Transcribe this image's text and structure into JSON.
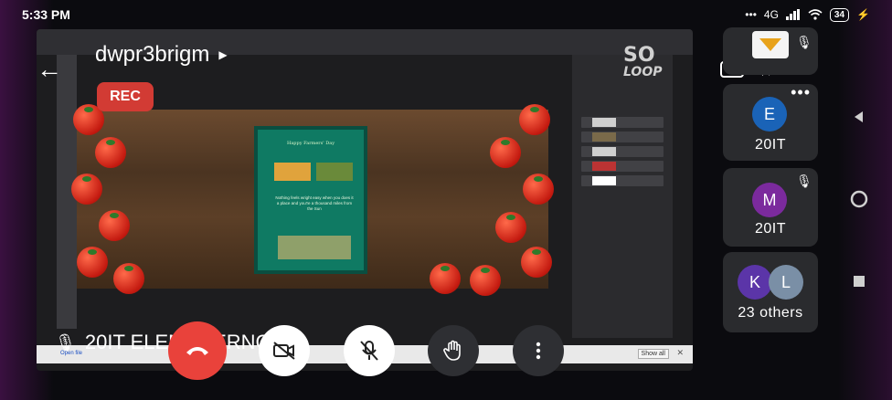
{
  "status_bar": {
    "time": "5:33 PM",
    "network": "4G",
    "battery": "34"
  },
  "meeting": {
    "code": "dwpr3brigm",
    "rec_label": "REC",
    "presenter_label": "20IT ELENA FERNCY"
  },
  "shared_screen": {
    "card_title": "Happy Farmers' Day",
    "card_text": "Nothing feels wright easy when you does it a place and you're a thousand miles from the Sun",
    "watermark_top": "SO",
    "watermark_bottom": "LOOP",
    "taskbar_link": "Open file",
    "taskbar_button": "Show all"
  },
  "participants": [
    {
      "type": "logo",
      "muted": true
    },
    {
      "initial": "E",
      "name": "20IT",
      "color": "#1a63b7"
    },
    {
      "initial": "M",
      "name": "20IT",
      "color": "#7b2a9d",
      "muted": true
    },
    {
      "initials": [
        "K",
        "L"
      ],
      "name": "23 others",
      "colors": [
        "#5b35a8",
        "#7a8fa6"
      ]
    }
  ],
  "icons": {
    "back": "back-arrow-icon",
    "switch_camera": "switch-camera-icon",
    "speaker": "speaker-icon",
    "end_call": "end-call-icon",
    "camera_off": "camera-off-icon",
    "mic_off": "mic-off-icon",
    "raise_hand": "raise-hand-icon",
    "more": "more-vertical-icon"
  },
  "colors": {
    "end_call": "#e9423b",
    "rec": "#d23b34",
    "tile_bg": "#2a2b2e"
  }
}
